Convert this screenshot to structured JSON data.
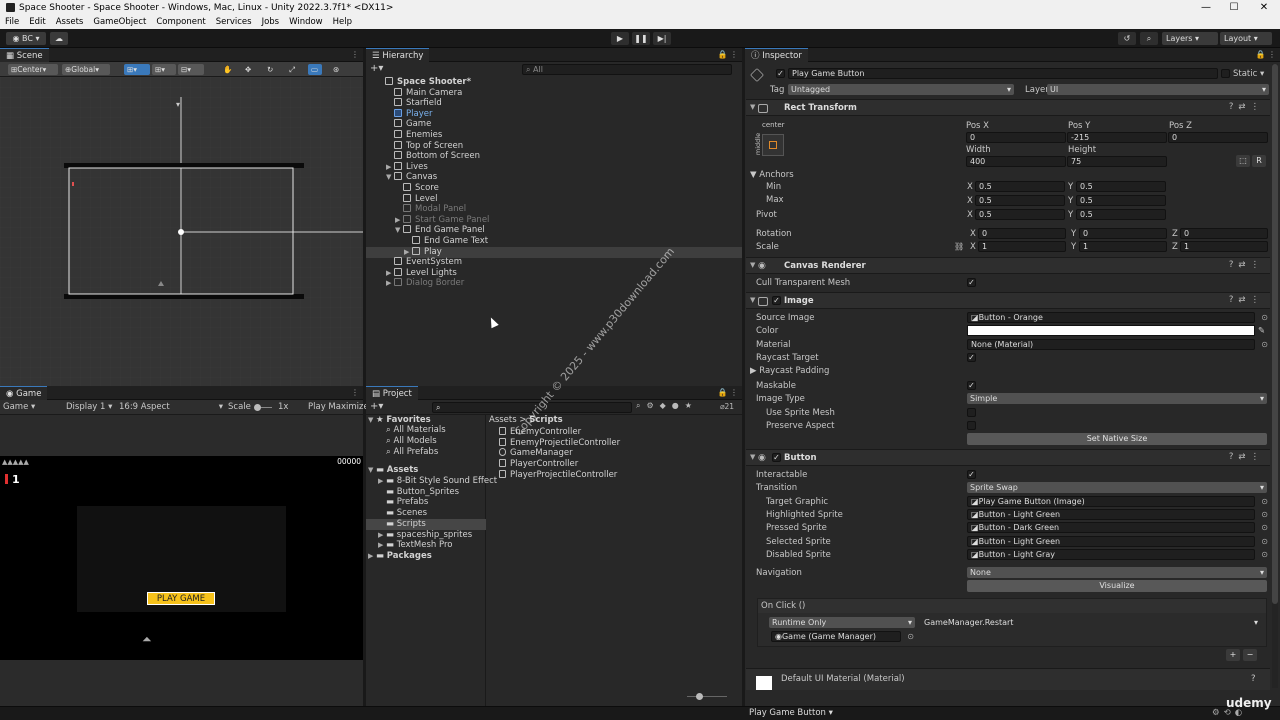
{
  "window": {
    "title": "Space Shooter - Space Shooter - Windows, Mac, Linux - Unity 2022.3.7f1* <DX11>"
  },
  "menu": [
    "File",
    "Edit",
    "Assets",
    "GameObject",
    "Component",
    "Services",
    "Jobs",
    "Window",
    "Help"
  ],
  "toolbar": {
    "account": "BC",
    "layers": "Layers",
    "layout": "Layout"
  },
  "scene": {
    "tab": "Scene",
    "pivot": "Center",
    "space": "Global"
  },
  "game": {
    "tab": "Game",
    "mode": "Game",
    "display": "Display 1",
    "aspect": "16:9 Aspect",
    "scale_label": "Scale",
    "scale_value": "1x",
    "play_mode": "Play Maximize",
    "score": "00000",
    "lives": "1",
    "play_button": "PLAY GAME"
  },
  "hierarchy": {
    "tab": "Hierarchy",
    "search": "All",
    "items": [
      {
        "label": "Space Shooter*",
        "depth": 0,
        "type": "scene",
        "bold": true
      },
      {
        "label": "Main Camera",
        "depth": 1
      },
      {
        "label": "Starfield",
        "depth": 1
      },
      {
        "label": "Player",
        "depth": 1,
        "type": "prefab"
      },
      {
        "label": "Game",
        "depth": 1
      },
      {
        "label": "Enemies",
        "depth": 1
      },
      {
        "label": "Top of Screen",
        "depth": 1
      },
      {
        "label": "Bottom of Screen",
        "depth": 1
      },
      {
        "label": "Lives",
        "depth": 1,
        "arrow": "▶"
      },
      {
        "label": "Canvas",
        "depth": 1,
        "arrow": "▼"
      },
      {
        "label": "Score",
        "depth": 2
      },
      {
        "label": "Level",
        "depth": 2
      },
      {
        "label": "Modal Panel",
        "depth": 2,
        "type": "dim"
      },
      {
        "label": "Start Game Panel",
        "depth": 2,
        "type": "dim",
        "arrow": "▶"
      },
      {
        "label": "End Game Panel",
        "depth": 2,
        "arrow": "▼"
      },
      {
        "label": "End Game Text",
        "depth": 3
      },
      {
        "label": "Play",
        "depth": 3,
        "arrow": "▶",
        "selected": true
      },
      {
        "label": "EventSystem",
        "depth": 1
      },
      {
        "label": "Level Lights",
        "depth": 1,
        "arrow": "▶"
      },
      {
        "label": "Dialog Border",
        "depth": 1,
        "type": "dim",
        "arrow": "▶"
      }
    ]
  },
  "project": {
    "tab": "Project",
    "count": "21",
    "breadcrumb": [
      "Assets",
      "Scripts"
    ],
    "favorites_label": "Favorites",
    "favorites": [
      "All Materials",
      "All Models",
      "All Prefabs"
    ],
    "assets_label": "Assets",
    "folders": [
      "8-Bit Style Sound Effect",
      "Button_Sprites",
      "Prefabs",
      "Scenes",
      "Scripts",
      "spaceship_sprites",
      "TextMesh Pro"
    ],
    "packages_label": "Packages",
    "files": [
      "EnemyController",
      "EnemyProjectileController",
      "GameManager",
      "PlayerController",
      "PlayerProjectileController"
    ]
  },
  "inspector": {
    "tab": "Inspector",
    "object_name": "Play Game Button",
    "static_label": "Static",
    "tag_label": "Tag",
    "tag": "Untagged",
    "layer_label": "Layer",
    "layer": "UI",
    "rect": {
      "name": "Rect Transform",
      "anchor_preset": "center",
      "side": "middle",
      "posx_label": "Pos X",
      "posy_label": "Pos Y",
      "posz_label": "Pos Z",
      "posx": "0",
      "posy": "-215",
      "posz": "0",
      "width_label": "Width",
      "height_label": "Height",
      "width": "400",
      "height": "75",
      "anchors_label": "Anchors",
      "min_label": "Min",
      "max_label": "Max",
      "pivot_label": "Pivot",
      "min_x": "0.5",
      "min_y": "0.5",
      "max_x": "0.5",
      "max_y": "0.5",
      "pivot_x": "0.5",
      "pivot_y": "0.5",
      "rotation_label": "Rotation",
      "scale_label": "Scale",
      "rot_x": "0",
      "rot_y": "0",
      "rot_z": "0",
      "scale_x": "1",
      "scale_y": "1",
      "scale_z": "1",
      "r_button": "R"
    },
    "canvas_renderer": {
      "name": "Canvas Renderer",
      "cull_label": "Cull Transparent Mesh"
    },
    "image": {
      "name": "Image",
      "source_label": "Source Image",
      "source": "Button - Orange",
      "color_label": "Color",
      "color": "#ffffff",
      "material_label": "Material",
      "material": "None (Material)",
      "raycast_label": "Raycast Target",
      "padding_label": "Raycast Padding",
      "maskable_label": "Maskable",
      "type_label": "Image Type",
      "type": "Simple",
      "sprite_mesh_label": "Use Sprite Mesh",
      "preserve_label": "Preserve Aspect",
      "native_button": "Set Native Size"
    },
    "button": {
      "name": "Button",
      "interactable_label": "Interactable",
      "transition_label": "Transition",
      "transition": "Sprite Swap",
      "target_label": "Target Graphic",
      "target": "Play Game Button (Image)",
      "highlighted_label": "Highlighted Sprite",
      "highlighted": "Button - Light Green",
      "pressed_label": "Pressed Sprite",
      "pressed": "Button - Dark Green",
      "selected_label": "Selected Sprite",
      "selected": "Button - Light Green",
      "disabled_label": "Disabled Sprite",
      "disabled": "Button - Light Gray",
      "navigation_label": "Navigation",
      "navigation": "None",
      "visualize_button": "Visualize",
      "onclick_label": "On Click ()",
      "runtime": "Runtime Only",
      "function": "GameManager.Restart",
      "object": "Game (Game Manager)"
    },
    "material_footer": "Default UI Material (Material)"
  },
  "statusbar": {
    "selection": "Play Game Button"
  },
  "watermark": "Copyright © 2025 - www.p30download.com",
  "udemy": "udemy",
  "colors": {
    "accent": "#3a79bb",
    "selection": "#2c5d87",
    "play_button": "#f7c21a"
  }
}
